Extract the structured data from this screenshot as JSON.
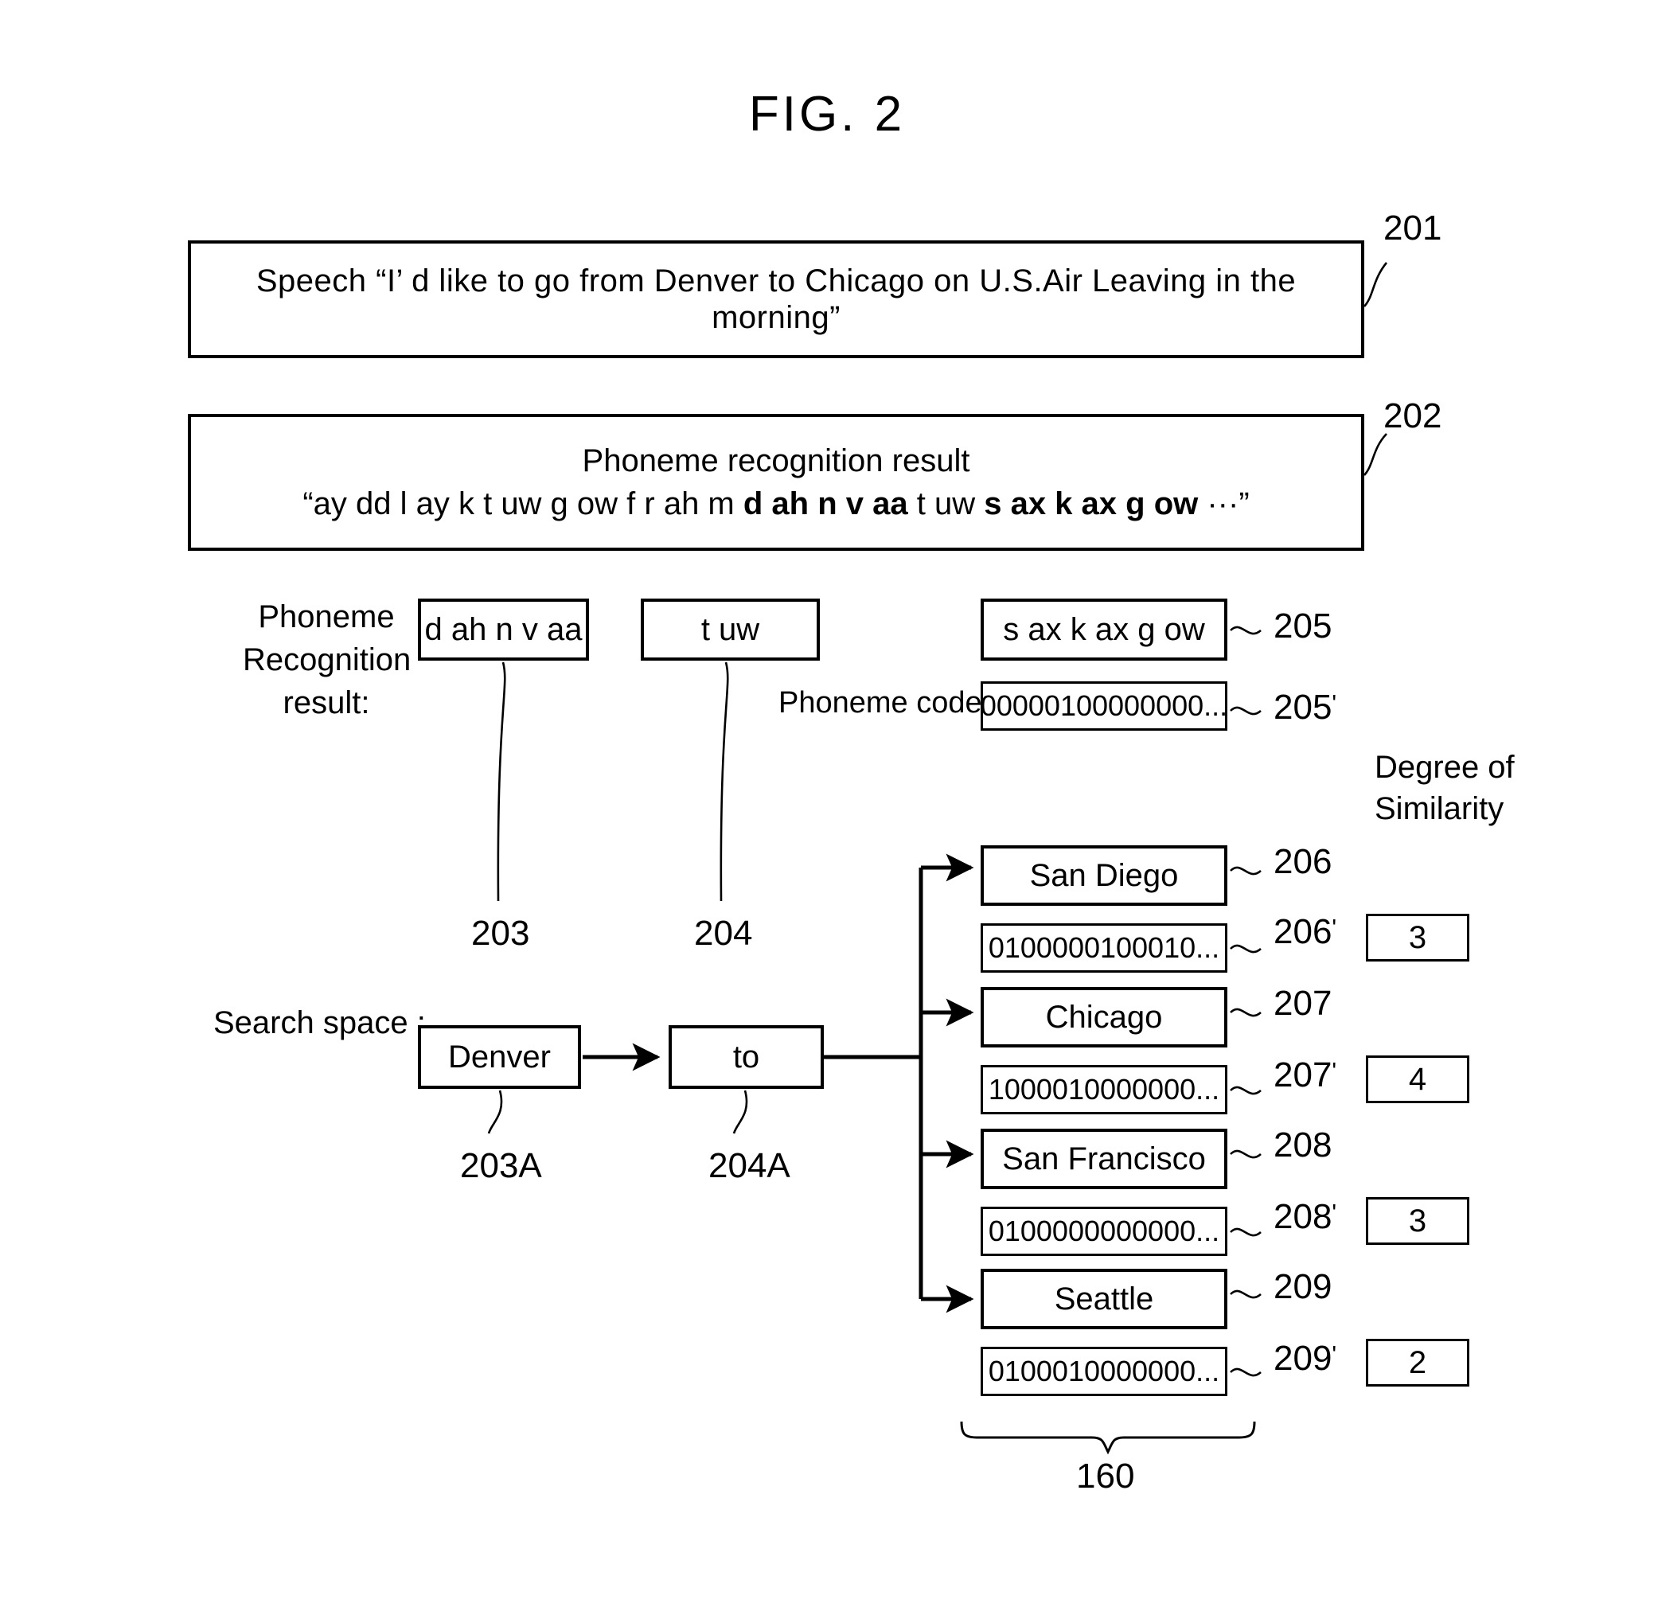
{
  "figure": {
    "title": "FIG. 2"
  },
  "speech": {
    "text": "Speech “I’ d like to go from Denver  to Chicago on U.S.Air Leaving in the morning”",
    "ref": "201"
  },
  "phoneme_recognition_banner": {
    "heading": "Phoneme recognition result",
    "sequence_open": "“ay dd l ay k t uw g ow f r ah m ",
    "sequence_bold1": "d ah n v aa",
    "sequence_mid": " t uw ",
    "sequence_bold2": "s ax k ax g ow",
    "sequence_close": " ···”",
    "ref": "202"
  },
  "phoneme_section": {
    "label": "Phoneme\nRecognition\nresult:",
    "codes_label": "Phoneme codes:",
    "items": [
      {
        "text": "d ah n v aa",
        "ref": "203"
      },
      {
        "text": "t uw",
        "ref": "204"
      },
      {
        "text": "s ax k ax g ow",
        "ref": "205"
      }
    ],
    "code": {
      "text": "00000100000000...",
      "ref": "205",
      "prime": "'"
    }
  },
  "search_space": {
    "label": "Search space :",
    "nodes": [
      {
        "text": "Denver",
        "ref": "203A"
      },
      {
        "text": "to",
        "ref": "204A"
      }
    ]
  },
  "degree_header": "Degree of\nSimilarity",
  "candidates": [
    {
      "name": "San Diego",
      "name_ref": "206",
      "code": "0100000100010...",
      "code_ref": "206",
      "prime": "'",
      "similarity": "3"
    },
    {
      "name": "Chicago",
      "name_ref": "207",
      "code": "1000010000000...",
      "code_ref": "207",
      "prime": "'",
      "similarity": "4"
    },
    {
      "name": "San Francisco",
      "name_ref": "208",
      "code": "0100000000000...",
      "code_ref": "208",
      "prime": "'",
      "similarity": "3"
    },
    {
      "name": "Seattle",
      "name_ref": "209",
      "code": "0100010000000...",
      "code_ref": "209",
      "prime": "'",
      "similarity": "2"
    }
  ],
  "group_brace": {
    "ref": "160"
  },
  "colors": {
    "ink": "#000000",
    "paper": "#ffffff"
  }
}
